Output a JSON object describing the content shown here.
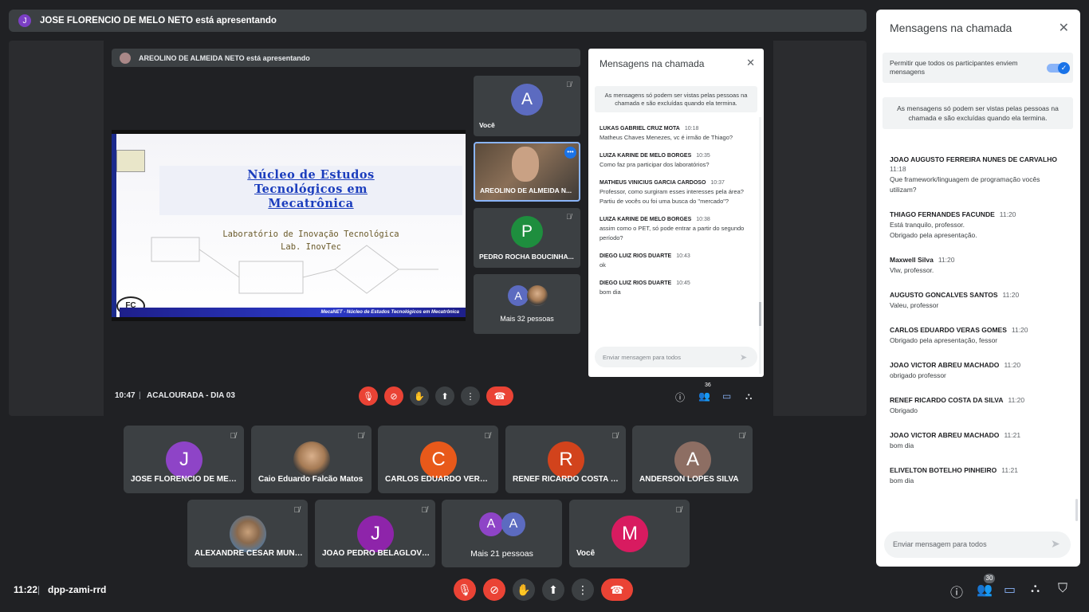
{
  "presenter_bar": {
    "avatar_letter": "J",
    "text": "JOSE FLORENCIO DE MELO NETO está apresentando"
  },
  "shared_screen": {
    "presenter_bar_text": "AREOLINO DE ALMEIDA NETO está apresentando",
    "slide": {
      "title_line1": "Núcleo de Estudos",
      "title_line2": "Tecnológicos em",
      "title_line3": "Mecatrônica",
      "subtitle1": "Laboratório de Inovação Tecnológica",
      "subtitle2": "Lab. InovTec",
      "footer": "MecaNET - Núcleo de Estudos Tecnológicos em Mecatrônica",
      "badge": "FC"
    },
    "tiles": [
      {
        "kind": "avatar",
        "letter": "A",
        "color": "#5c6bc0",
        "label": "Você"
      },
      {
        "kind": "video",
        "label": "AREOLINO DE ALMEIDA N..."
      },
      {
        "kind": "avatar",
        "letter": "P",
        "color": "#1e8e3e",
        "label": "PEDRO ROCHA BOUCINHA..."
      },
      {
        "kind": "more",
        "letter": "A",
        "label": "Mais 32 pessoas"
      }
    ],
    "chat": {
      "title": "Mensagens na chamada",
      "note": "As mensagens só podem ser vistas pelas pessoas na chamada e são excluídas quando ela termina.",
      "messages": [
        {
          "name": "LUKAS GABRIEL CRUZ MOTA",
          "time": "10:18",
          "text": "Matheus Chaves Menezes, vc é irmão de Thiago?"
        },
        {
          "name": "LUIZA KARINE DE MELO BORGES",
          "time": "10:35",
          "text": "Como faz pra participar dos laboratórios?"
        },
        {
          "name": "MATHEUS VINICIUS GARCIA CARDOSO",
          "time": "10:37",
          "text": "Professor, como surgiram esses interesses pela área? Partiu de vocês ou foi uma busca do \"mercado\"?"
        },
        {
          "name": "LUIZA KARINE DE MELO BORGES",
          "time": "10:38",
          "text": "assim como o PET, só pode entrar a partir do segundo período?"
        },
        {
          "name": "DIEGO LUIZ RIOS DUARTE",
          "time": "10:43",
          "text": "ok"
        },
        {
          "name": "DIEGO LUIZ RIOS DUARTE",
          "time": "10:45",
          "text": "bom dia"
        }
      ],
      "input_placeholder": "Enviar mensagem para todos"
    },
    "controls": {
      "time": "10:47",
      "separator": "|",
      "meeting": "ACALOURADA - DIA 03",
      "people_count": "36"
    }
  },
  "participants": [
    {
      "kind": "avatar",
      "letter": "J",
      "color": "#8e44c7",
      "label": "JOSE FLORENCIO DE MEL..."
    },
    {
      "kind": "photo",
      "label": "Caio Eduardo Falcão Matos"
    },
    {
      "kind": "avatar",
      "letter": "C",
      "color": "#e8591a",
      "label": "CARLOS EDUARDO VERAS..."
    },
    {
      "kind": "avatar",
      "letter": "R",
      "color": "#d2431c",
      "label": "RENEF RICARDO COSTA D..."
    },
    {
      "kind": "avatar",
      "letter": "A",
      "color": "#8d6e63",
      "label": "ANDERSON LOPES SILVA"
    },
    {
      "kind": "photo2",
      "label": "ALEXANDRE CESAR MUNI..."
    },
    {
      "kind": "avatar",
      "letter": "J",
      "color": "#8e24aa",
      "label": "JOAO PEDRO BELAGLOVI..."
    },
    {
      "kind": "more",
      "letter1": "A",
      "letter2": "A",
      "color1": "#8e44c7",
      "color2": "#5c6bc0",
      "label": "Mais 21 pessoas"
    },
    {
      "kind": "avatar",
      "letter": "M",
      "color": "#d81b60",
      "label": "Você"
    }
  ],
  "bottom_bar": {
    "time": "11:22",
    "separator": "|",
    "meeting_code": "dpp-zami-rrd",
    "people_count": "30"
  },
  "chat_panel": {
    "title": "Mensagens na chamada",
    "toggle_label": "Permitir que todos os participantes enviem mensagens",
    "note": "As mensagens só podem ser vistas pelas pessoas na chamada e são excluídas quando ela termina.",
    "messages": [
      {
        "name": "JOAO AUGUSTO FERREIRA NUNES DE CARVALHO",
        "time": "11:18",
        "text": "Que framework/linguagem de programação vocês utilizam?"
      },
      {
        "name": "THIAGO FERNANDES FACUNDE",
        "time": "11:20",
        "text": "Está tranquilo, professor.\nObrigado pela apresentação."
      },
      {
        "name": "Maxwell Silva",
        "time": "11:20",
        "text": "Vlw, professor."
      },
      {
        "name": "AUGUSTO GONCALVES SANTOS",
        "time": "11:20",
        "text": "Valeu, professor"
      },
      {
        "name": "CARLOS EDUARDO VERAS GOMES",
        "time": "11:20",
        "text": "Obrigado pela apresentação, fessor"
      },
      {
        "name": "JOAO VICTOR ABREU MACHADO",
        "time": "11:20",
        "text": "obrigado professor"
      },
      {
        "name": "RENEF RICARDO COSTA DA SILVA",
        "time": "11:20",
        "text": "Obrigado"
      },
      {
        "name": "JOAO VICTOR ABREU MACHADO",
        "time": "11:21",
        "text": "bom dia"
      },
      {
        "name": "ELIVELTON BOTELHO PINHEIRO",
        "time": "11:21",
        "text": "bom dia"
      }
    ],
    "input_placeholder": "Enviar mensagem para todos"
  }
}
